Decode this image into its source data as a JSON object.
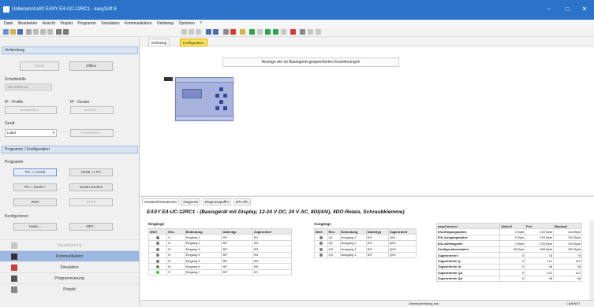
{
  "window": {
    "title": "Unbenannt.e80 EASY E4-UC-12RC1 - easySoft 8"
  },
  "menu": [
    "Datei",
    "Bearbeiten",
    "Ansicht",
    "Projekt",
    "Programm",
    "Simulation",
    "Kommunikation",
    "Onlinetop",
    "Optionen",
    "?"
  ],
  "left": {
    "connection": {
      "header": "Verbindung",
      "online": "Online",
      "offline": "Offline",
      "interface_label": "Schnittstelle",
      "interface_value": "192.168.0.10",
      "ip_profile_label": "IP - Profile",
      "ip_devices_label": "IP - Geräte",
      "edit_button": "Bearbeiten...",
      "search_button": "Suchen...",
      "device_label": "Gerät",
      "device_value": "Lokal",
      "ext_button": "Erweiterten..."
    },
    "program": {
      "header": "Programm / Konfiguration",
      "program_label": "Programm",
      "pc_to_device": "PC => Gerät",
      "device_to_pc": "Gerät => PC",
      "pc_device_q": "PC = Gerät ?",
      "delete_device": "Gerät Löschen",
      "run": "RUN",
      "stop": "STOP",
      "config_label": "Konfigurieren",
      "card": "Karte...",
      "net": "NET..."
    },
    "nav": {
      "visualization": "Visualisierung",
      "communication": "Kommunikation",
      "simulation": "Simulation",
      "programming": "Programmierung",
      "project": "Projekt"
    }
  },
  "work": {
    "tabs": [
      "Onlinetop",
      "Konfiguration"
    ],
    "banner": "Anzeige der im Basisgerät gespeicherten Erweiterungen"
  },
  "bottom": {
    "tabs": [
      "Geräteinformationen",
      "Diagnose",
      "Diagnosepuffer",
      "Info Info"
    ],
    "headline": "EASY E4-UC-12RC1 - (Basisgerät mit Display, 12-24 V DC, 24 V AC, 8DI(4AI), 4DO-Relais, Schraubklemme)",
    "inputs": {
      "caption": "Eingänge",
      "headers": [
        "Wert",
        "Res.",
        "Bedeutung",
        "Datentyp",
        "Zugeordnet"
      ],
      "rows": [
        {
          "on": false,
          "res": "I1",
          "name": "Eingang 1",
          "type": "BIT",
          "assign": "I01"
        },
        {
          "on": false,
          "res": "I2",
          "name": "Eingang 2",
          "type": "BIT",
          "assign": "I02"
        },
        {
          "on": false,
          "res": "I3",
          "name": "Eingang 3",
          "type": "BIT",
          "assign": "I03"
        },
        {
          "on": false,
          "res": "I4",
          "name": "Eingang 4",
          "type": "BIT",
          "assign": "I04"
        },
        {
          "on": false,
          "res": "I5",
          "name": "Eingang 5",
          "type": "BIT",
          "assign": "I05"
        },
        {
          "on": false,
          "res": "I6",
          "name": "Eingang 6",
          "type": "BIT",
          "assign": "I06"
        },
        {
          "on": true,
          "res": "I7",
          "name": "Eingang 7",
          "type": "BIT",
          "assign": "I07"
        }
      ]
    },
    "outputs": {
      "caption": "Ausgänge",
      "headers": [
        "Wert",
        "Res.",
        "Bedeutung",
        "Datentyp",
        "Zugeordnet"
      ],
      "rows": [
        {
          "on": false,
          "res": "Q1",
          "name": "Ausgang 1",
          "type": "BIT",
          "assign": "Q01"
        },
        {
          "on": false,
          "res": "Q2",
          "name": "Ausgang 2",
          "type": "BIT",
          "assign": "Q02"
        },
        {
          "on": false,
          "res": "Q3",
          "name": "Ausgang 3",
          "type": "BIT",
          "assign": "Q03"
        },
        {
          "on": false,
          "res": "Q4",
          "name": "Ausgang 4",
          "type": "BIT",
          "assign": "Q04"
        }
      ]
    },
    "easy": {
      "headers": [
        "easyConnect",
        "Aktuell",
        "Frei",
        "Maximal"
      ],
      "rows": [
        {
          "name": "E/A-Eingangsbytes",
          "cur": "1 Byte",
          "free": "233 Byte",
          "max": "234 Byte"
        },
        {
          "name": "E/A-Ausgangsbytes",
          "cur": "0 Byte",
          "free": "234 Byte",
          "max": "234 Byte"
        },
        {
          "name": "E/A-Abbildgröße",
          "cur": "1 Byte",
          "free": "233 Byte",
          "max": "234 Byte"
        },
        {
          "name": "Konfigurationsdaten",
          "cur": "26 Byte",
          "free": "358 Byte",
          "max": "384 Byte"
        },
        {
          "name": "Zugeordnete I",
          "cur": "0",
          "free": "78",
          "max": "78"
        },
        {
          "name": "Zugeordnete Q",
          "cur": "0",
          "free": "112",
          "max": "112"
        },
        {
          "name": "Zugeordnete IA",
          "cur": "0",
          "free": "48",
          "max": "48"
        },
        {
          "name": "Zugeordnete QA",
          "cur": "0",
          "free": "112",
          "max": "112"
        },
        {
          "name": "Zugeordnete QA",
          "cur": "0",
          "free": "48",
          "max": "48"
        }
      ]
    }
  },
  "status": {
    "left": "Zielbeschreibung aus",
    "right": "CAN/NET"
  }
}
